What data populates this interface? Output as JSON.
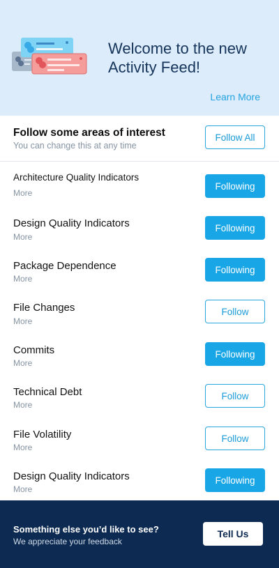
{
  "hero": {
    "title": "Welcome to the new Activity Feed!",
    "learn_more": "Learn More"
  },
  "interests": {
    "title": "Follow some areas of interest",
    "subtitle": "You can change this at any time",
    "follow_all": "Follow All"
  },
  "topics": [
    {
      "name": "Architecture Quality Indicators",
      "more": "More",
      "action": "Following"
    },
    {
      "name": "Design Quality Indicators",
      "more": "More",
      "action": "Following"
    },
    {
      "name": "Package Dependence",
      "more": "More",
      "action": "Following"
    },
    {
      "name": "File Changes",
      "more": "More",
      "action": "Follow"
    },
    {
      "name": "Commits",
      "more": "More",
      "action": "Following"
    },
    {
      "name": "Technical Debt",
      "more": "More",
      "action": "Follow"
    },
    {
      "name": "File Volatility",
      "more": "More",
      "action": "Follow"
    },
    {
      "name": "Design Quality Indicators",
      "more": "More",
      "action": "Following"
    }
  ],
  "footer": {
    "title": "Something else you’d like to see?",
    "subtitle": "We appreciate your feedback",
    "button": "Tell Us"
  },
  "colors": {
    "hero_bg": "#dcecfb",
    "accent": "#19a6e6",
    "footer_bg": "#0d2b52",
    "muted_text": "#8593a3"
  }
}
